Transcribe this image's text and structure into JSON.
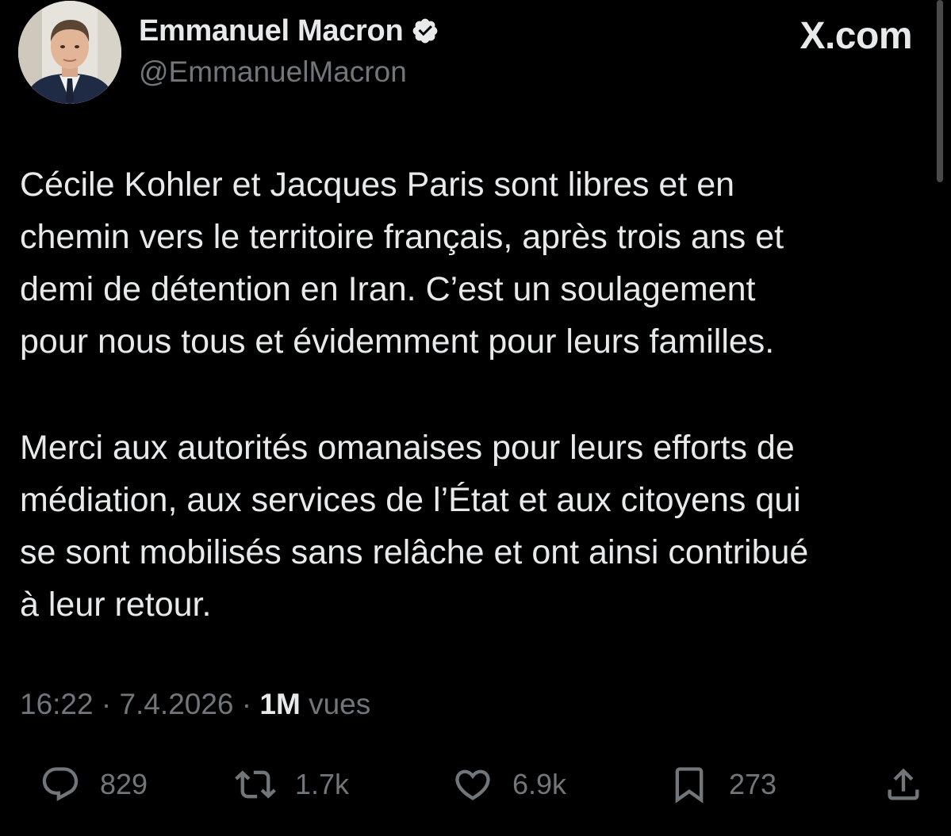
{
  "header": {
    "display_name": "Emmanuel Macron",
    "handle": "@EmmanuelMacron",
    "brand": "X.com"
  },
  "tweet": {
    "paragraphs": [
      [
        "Cécile Kohler et Jacques Paris sont libres et en",
        "chemin vers le territoire français, après trois ans et",
        "demi de détention en Iran. C’est un soulagement",
        "pour nous tous et évidemment pour leurs familles."
      ],
      [
        "Merci aux autorités omanaises pour leurs efforts de",
        "médiation, aux services de l’État et aux citoyens qui",
        "se sont mobilisés sans relâche et ont ainsi contribué",
        "à leur retour."
      ]
    ]
  },
  "meta": {
    "time": "16:22",
    "separator": "·",
    "date": "7.4.2026",
    "views_count": "1M",
    "views_label": "vues"
  },
  "actions": {
    "replies": "829",
    "reposts": "1.7k",
    "likes": "6.9k",
    "bookmarks": "273"
  },
  "colors": {
    "background": "#000000",
    "primary_text": "#e7e9ea",
    "secondary_text": "#71767b",
    "verified_badge": "#e7e9ea"
  },
  "icons": [
    "verified-badge-icon",
    "reply-icon",
    "repost-icon",
    "like-icon",
    "bookmark-icon",
    "share-icon"
  ]
}
